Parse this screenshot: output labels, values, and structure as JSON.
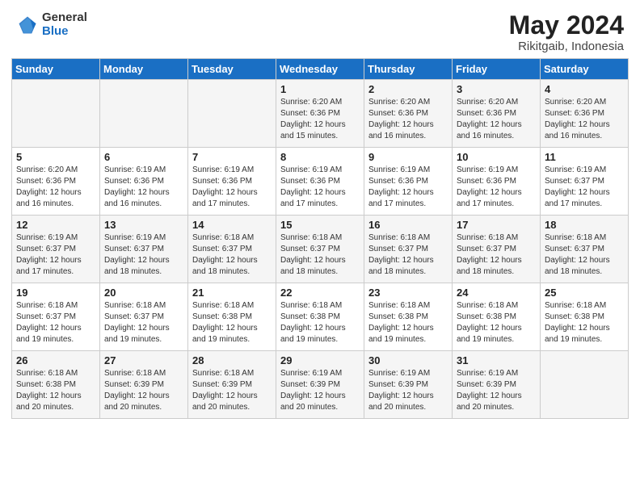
{
  "header": {
    "logo_general": "General",
    "logo_blue": "Blue",
    "title": "May 2024",
    "location": "Rikitgaib, Indonesia"
  },
  "days_of_week": [
    "Sunday",
    "Monday",
    "Tuesday",
    "Wednesday",
    "Thursday",
    "Friday",
    "Saturday"
  ],
  "weeks": [
    [
      {
        "day": "",
        "info": ""
      },
      {
        "day": "",
        "info": ""
      },
      {
        "day": "",
        "info": ""
      },
      {
        "day": "1",
        "info": "Sunrise: 6:20 AM\nSunset: 6:36 PM\nDaylight: 12 hours\nand 15 minutes."
      },
      {
        "day": "2",
        "info": "Sunrise: 6:20 AM\nSunset: 6:36 PM\nDaylight: 12 hours\nand 16 minutes."
      },
      {
        "day": "3",
        "info": "Sunrise: 6:20 AM\nSunset: 6:36 PM\nDaylight: 12 hours\nand 16 minutes."
      },
      {
        "day": "4",
        "info": "Sunrise: 6:20 AM\nSunset: 6:36 PM\nDaylight: 12 hours\nand 16 minutes."
      }
    ],
    [
      {
        "day": "5",
        "info": "Sunrise: 6:20 AM\nSunset: 6:36 PM\nDaylight: 12 hours\nand 16 minutes."
      },
      {
        "day": "6",
        "info": "Sunrise: 6:19 AM\nSunset: 6:36 PM\nDaylight: 12 hours\nand 16 minutes."
      },
      {
        "day": "7",
        "info": "Sunrise: 6:19 AM\nSunset: 6:36 PM\nDaylight: 12 hours\nand 17 minutes."
      },
      {
        "day": "8",
        "info": "Sunrise: 6:19 AM\nSunset: 6:36 PM\nDaylight: 12 hours\nand 17 minutes."
      },
      {
        "day": "9",
        "info": "Sunrise: 6:19 AM\nSunset: 6:36 PM\nDaylight: 12 hours\nand 17 minutes."
      },
      {
        "day": "10",
        "info": "Sunrise: 6:19 AM\nSunset: 6:36 PM\nDaylight: 12 hours\nand 17 minutes."
      },
      {
        "day": "11",
        "info": "Sunrise: 6:19 AM\nSunset: 6:37 PM\nDaylight: 12 hours\nand 17 minutes."
      }
    ],
    [
      {
        "day": "12",
        "info": "Sunrise: 6:19 AM\nSunset: 6:37 PM\nDaylight: 12 hours\nand 17 minutes."
      },
      {
        "day": "13",
        "info": "Sunrise: 6:19 AM\nSunset: 6:37 PM\nDaylight: 12 hours\nand 18 minutes."
      },
      {
        "day": "14",
        "info": "Sunrise: 6:18 AM\nSunset: 6:37 PM\nDaylight: 12 hours\nand 18 minutes."
      },
      {
        "day": "15",
        "info": "Sunrise: 6:18 AM\nSunset: 6:37 PM\nDaylight: 12 hours\nand 18 minutes."
      },
      {
        "day": "16",
        "info": "Sunrise: 6:18 AM\nSunset: 6:37 PM\nDaylight: 12 hours\nand 18 minutes."
      },
      {
        "day": "17",
        "info": "Sunrise: 6:18 AM\nSunset: 6:37 PM\nDaylight: 12 hours\nand 18 minutes."
      },
      {
        "day": "18",
        "info": "Sunrise: 6:18 AM\nSunset: 6:37 PM\nDaylight: 12 hours\nand 18 minutes."
      }
    ],
    [
      {
        "day": "19",
        "info": "Sunrise: 6:18 AM\nSunset: 6:37 PM\nDaylight: 12 hours\nand 19 minutes."
      },
      {
        "day": "20",
        "info": "Sunrise: 6:18 AM\nSunset: 6:37 PM\nDaylight: 12 hours\nand 19 minutes."
      },
      {
        "day": "21",
        "info": "Sunrise: 6:18 AM\nSunset: 6:38 PM\nDaylight: 12 hours\nand 19 minutes."
      },
      {
        "day": "22",
        "info": "Sunrise: 6:18 AM\nSunset: 6:38 PM\nDaylight: 12 hours\nand 19 minutes."
      },
      {
        "day": "23",
        "info": "Sunrise: 6:18 AM\nSunset: 6:38 PM\nDaylight: 12 hours\nand 19 minutes."
      },
      {
        "day": "24",
        "info": "Sunrise: 6:18 AM\nSunset: 6:38 PM\nDaylight: 12 hours\nand 19 minutes."
      },
      {
        "day": "25",
        "info": "Sunrise: 6:18 AM\nSunset: 6:38 PM\nDaylight: 12 hours\nand 19 minutes."
      }
    ],
    [
      {
        "day": "26",
        "info": "Sunrise: 6:18 AM\nSunset: 6:38 PM\nDaylight: 12 hours\nand 20 minutes."
      },
      {
        "day": "27",
        "info": "Sunrise: 6:18 AM\nSunset: 6:39 PM\nDaylight: 12 hours\nand 20 minutes."
      },
      {
        "day": "28",
        "info": "Sunrise: 6:18 AM\nSunset: 6:39 PM\nDaylight: 12 hours\nand 20 minutes."
      },
      {
        "day": "29",
        "info": "Sunrise: 6:19 AM\nSunset: 6:39 PM\nDaylight: 12 hours\nand 20 minutes."
      },
      {
        "day": "30",
        "info": "Sunrise: 6:19 AM\nSunset: 6:39 PM\nDaylight: 12 hours\nand 20 minutes."
      },
      {
        "day": "31",
        "info": "Sunrise: 6:19 AM\nSunset: 6:39 PM\nDaylight: 12 hours\nand 20 minutes."
      },
      {
        "day": "",
        "info": ""
      }
    ]
  ]
}
